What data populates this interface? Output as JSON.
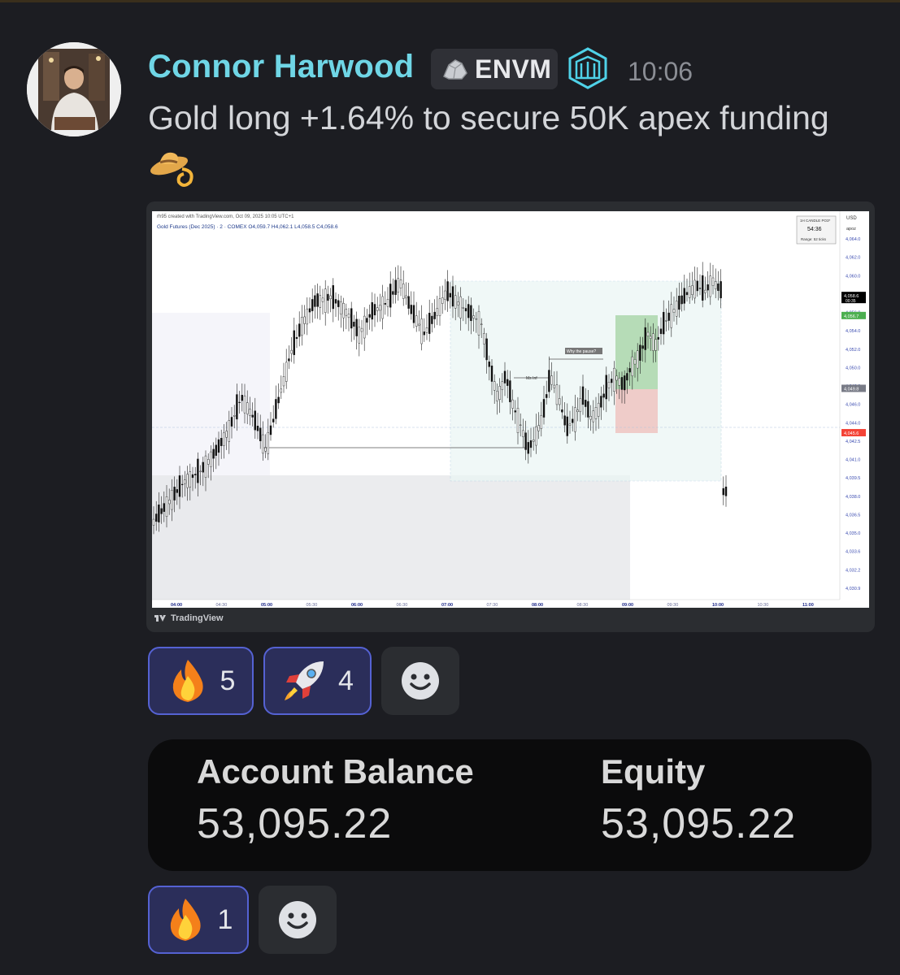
{
  "message": {
    "username": "Connor Harwood",
    "tag": "ENVM",
    "time": "10:06",
    "text": "Gold long +1.64% to secure 50K apex funding",
    "emoji": "cowboy-hat-lasso"
  },
  "embed": {
    "source": "TradingView",
    "header": "rh95 created with TradingView.com, Oct 09, 2025 10:05 UTC+1",
    "symbol_line": "Gold Futures (Dec 2025) · 2 · COMEX  O4,059.7  H4,062.1  L4,058.5  C4,058.6",
    "candle_box": {
      "title": "1H CANDLE PO3*",
      "timer": "54:36",
      "range": "Range: 52 ticks"
    },
    "currency": "USD",
    "sub_currency": "apoz",
    "annotation_pause": "Why the pause?",
    "annotation_ms": "Ms Inf"
  },
  "chart_data": {
    "type": "candlestick",
    "x_ticks": [
      "04:00",
      "04:30",
      "05:00",
      "05:30",
      "06:00",
      "06:30",
      "07:00",
      "07:30",
      "08:00",
      "08:30",
      "09:00",
      "09:30",
      "10:00",
      "10:30",
      "11:00"
    ],
    "y_ticks": [
      "4,064.0",
      "4,062.0",
      "4,060.0",
      "4,058.0",
      "4,056.0",
      "4,054.0",
      "4,052.0",
      "4,050.0",
      "4,048.0",
      "4,046.0",
      "4,044.0",
      "4,042.5",
      "4,041.0",
      "4,039.5",
      "4,038.0",
      "4,036.5",
      "4,035.0",
      "4,033.6",
      "4,032.2",
      "4,030.9"
    ],
    "price_labels": [
      {
        "value": "4,058.6",
        "sub": "00:35",
        "color": "#000000"
      },
      {
        "value": "4,056.7",
        "color": "#4caf50"
      },
      {
        "value": "4,049.8",
        "color": "#787b86"
      },
      {
        "value": "4,045.6",
        "color": "#f44336"
      }
    ],
    "ylim": [
      4030.9,
      4064.0
    ]
  },
  "reactions_1": [
    {
      "emoji": "fire",
      "count": "5"
    },
    {
      "emoji": "rocket",
      "count": "4"
    }
  ],
  "stats": {
    "balance_label": "Account Balance",
    "balance_value": "53,095.22",
    "equity_label": "Equity",
    "equity_value": "53,095.22"
  },
  "reactions_2": [
    {
      "emoji": "fire",
      "count": "1"
    }
  ]
}
